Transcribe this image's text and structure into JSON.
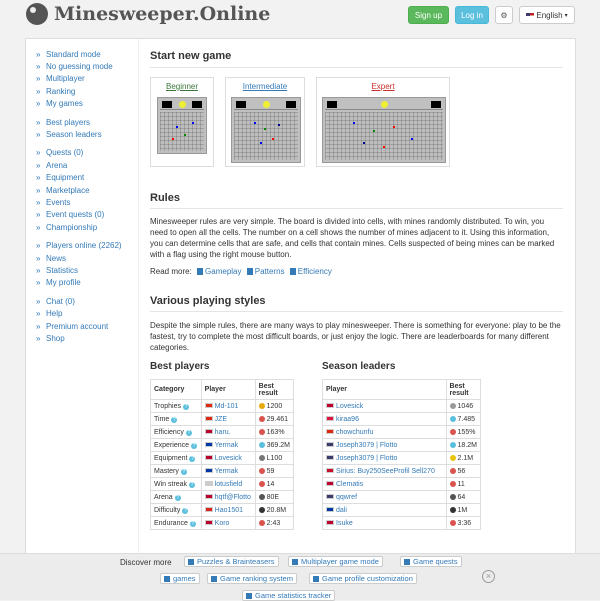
{
  "header": {
    "logo_text": "Minesweeper.Online",
    "signup": "Sign up",
    "login": "Log in",
    "language": "English"
  },
  "sidebar": {
    "groups": [
      [
        "Standard mode",
        "No guessing mode",
        "Multiplayer",
        "Ranking",
        "My games"
      ],
      [
        "Best players",
        "Season leaders"
      ],
      [
        "Quests (0)",
        "Arena",
        "Equipment",
        "Marketplace",
        "Events",
        "Event quests (0)",
        "Championship"
      ],
      [
        "Players online (2262)",
        "News",
        "Statistics",
        "My profile"
      ],
      [
        "Chat (0)",
        "Help",
        "Premium account",
        "Shop"
      ]
    ]
  },
  "start": {
    "title": "Start new game",
    "beginner": "Beginner",
    "intermediate": "Intermediate",
    "expert": "Expert"
  },
  "rules": {
    "title": "Rules",
    "text": "Minesweeper rules are very simple. The board is divided into cells, with mines randomly distributed. To win, you need to open all the cells. The number on a cell shows the number of mines adjacent to it. Using this information, you can determine cells that are safe, and cells that contain mines. Cells suspected of being mines can be marked with a flag using the right mouse button.",
    "read_more": "Read more:",
    "link_gameplay": "Gameplay",
    "link_patterns": "Patterns",
    "link_efficiency": "Efficiency"
  },
  "styles": {
    "title": "Various playing styles",
    "text": "Despite the simple rules, there are many ways to play minesweeper. There is something for everyone: play to be the fastest, try to complete the most difficult boards, or just enjoy the logic. There are leaderboards for many different categories."
  },
  "best_players": {
    "title": "Best players",
    "col_category": "Category",
    "col_player": "Player",
    "col_result": "Best result",
    "rows": [
      {
        "category": "Trophies",
        "player": "Md-101",
        "result": "1200",
        "flag": "#de2910",
        "icon": "#e8a90b"
      },
      {
        "category": "Time",
        "player": "JZE",
        "result": "29.461",
        "flag": "#de2910",
        "icon": "#d9534f"
      },
      {
        "category": "Efficiency",
        "player": "haru.",
        "result": "163%",
        "flag": "#bc002d",
        "icon": "#d9534f"
      },
      {
        "category": "Experience",
        "player": "Yermak",
        "result": "369.2M",
        "flag": "#0039a6",
        "icon": "#5bc0de"
      },
      {
        "category": "Equipment",
        "player": "Lovesick",
        "result": "L100",
        "flag": "#bc002d",
        "icon": "#777777"
      },
      {
        "category": "Mastery",
        "player": "Yermak",
        "result": "59",
        "flag": "#0039a6",
        "icon": "#d9534f"
      },
      {
        "category": "Win streak",
        "player": "lotusfield",
        "result": "14",
        "flag": "#cccccc",
        "icon": "#d9534f"
      },
      {
        "category": "Arena",
        "player": "hqtf@Flotto",
        "result": "80E",
        "flag": "#bc002d",
        "icon": "#555555"
      },
      {
        "category": "Difficulty",
        "player": "Hao1501",
        "result": "20.8M",
        "flag": "#da251d",
        "icon": "#333333"
      },
      {
        "category": "Endurance",
        "player": "Koro",
        "result": "2:43",
        "flag": "#bc002d",
        "icon": "#d9534f"
      }
    ]
  },
  "season_leaders": {
    "title": "Season leaders",
    "col_player": "Player",
    "col_result": "Best result",
    "rows": [
      {
        "player": "Lovesick",
        "result": "1046",
        "flag": "#bc002d",
        "icon": "#999999"
      },
      {
        "player": "kiraa96",
        "result": "7.485",
        "flag": "#dc143c",
        "icon": "#5bc0de"
      },
      {
        "player": "chowchunfu",
        "result": "155%",
        "flag": "#de2910",
        "icon": "#d9534f"
      },
      {
        "player": "Joseph3079 | Flotto",
        "result": "18.2M",
        "flag": "#3c3b6e",
        "icon": "#5bc0de"
      },
      {
        "player": "Joseph3079 | Flotto",
        "result": "2.1M",
        "flag": "#3c3b6e",
        "icon": "#e8c40b"
      },
      {
        "player": "Sirius: Buy250SeeProfil Sell270",
        "result": "56",
        "flag": "#c8102e",
        "icon": "#d9534f"
      },
      {
        "player": "Clematis",
        "result": "11",
        "flag": "#bc002d",
        "icon": "#d9534f"
      },
      {
        "player": "qqwref",
        "result": "64",
        "flag": "#3c3b6e",
        "icon": "#555555"
      },
      {
        "player": "dali",
        "result": "1M",
        "flag": "#0039a6",
        "icon": "#333333"
      },
      {
        "player": "Isuke",
        "result": "3:36",
        "flag": "#bc002d",
        "icon": "#d9534f"
      }
    ]
  },
  "discover": {
    "label": "Discover more",
    "chips": [
      "Puzzles & Brainteasers",
      "Multiplayer game mode",
      "Game quests",
      "games",
      "Game ranking system",
      "Game profile customization",
      "Game statistics tracker"
    ]
  }
}
